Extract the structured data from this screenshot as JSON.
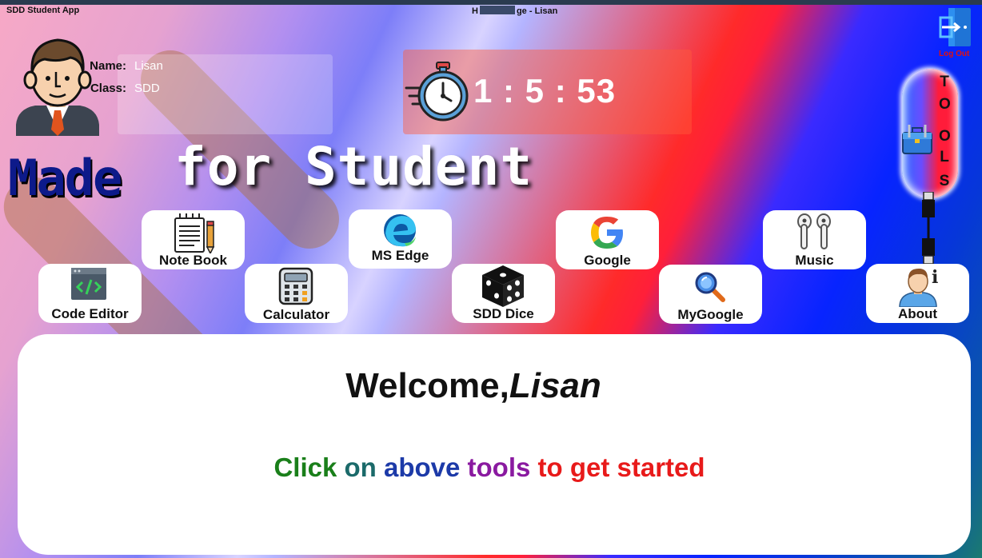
{
  "window": {
    "app_title": "SDD Student App",
    "center_title_left": "H",
    "center_title_right": "ge - Lisan"
  },
  "profile": {
    "name_label": "Name:",
    "name_value": "Lisan",
    "class_label": "Class:",
    "class_value": "SDD"
  },
  "timer": {
    "display": "1 : 5 : 53"
  },
  "banner": {
    "made": "Made",
    "for_student": "for Student"
  },
  "logout": {
    "label": "Log Out"
  },
  "tools": {
    "letters": [
      "T",
      "O",
      "O",
      "L",
      "S"
    ]
  },
  "info_glyph": "i",
  "apps": [
    {
      "label": "Code Editor",
      "icon": "code-editor-icon"
    },
    {
      "label": "Note Book",
      "icon": "notebook-icon"
    },
    {
      "label": "Calculator",
      "icon": "calculator-icon"
    },
    {
      "label": "MS Edge",
      "icon": "edge-icon"
    },
    {
      "label": "SDD Dice",
      "icon": "dice-icon"
    },
    {
      "label": "Google",
      "icon": "google-icon"
    },
    {
      "label": "MyGoogle",
      "icon": "magnifier-icon"
    },
    {
      "label": "Music",
      "icon": "earbuds-icon"
    },
    {
      "label": "About",
      "icon": "person-icon"
    }
  ],
  "welcome": {
    "greeting": "Welcome,",
    "name": "Lisan"
  },
  "instruction": {
    "words": [
      {
        "text": "Click",
        "color": "#1a7f1a"
      },
      {
        "text": "on",
        "color": "#1b6a6a"
      },
      {
        "text": "above",
        "color": "#1c3aa8"
      },
      {
        "text": "tools",
        "color": "#8a1aa0"
      },
      {
        "text": "to get started",
        "color": "#e81a1a"
      }
    ]
  }
}
